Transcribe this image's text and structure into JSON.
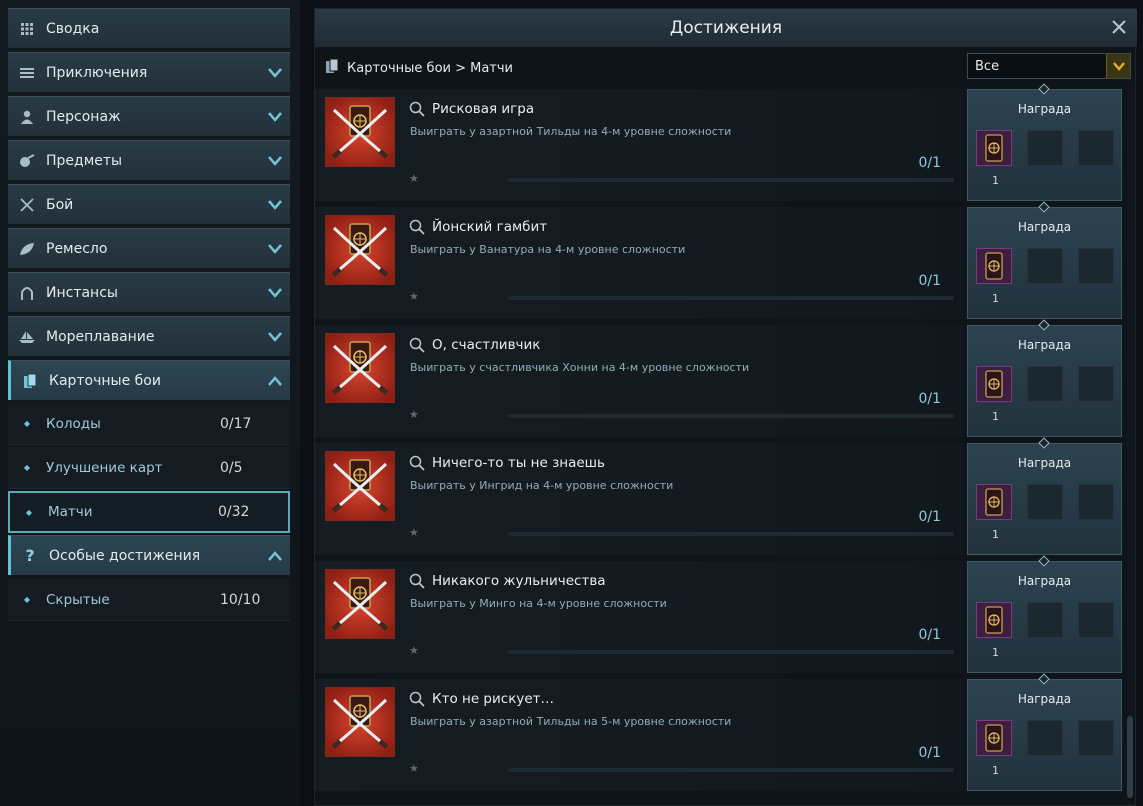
{
  "sidebar": {
    "items": [
      {
        "label": "Сводка",
        "icon": "grid-icon"
      },
      {
        "label": "Приключения",
        "icon": "list-icon"
      },
      {
        "label": "Персонаж",
        "icon": "person-icon"
      },
      {
        "label": "Предметы",
        "icon": "pouch-icon"
      },
      {
        "label": "Бой",
        "icon": "crossed-swords-icon"
      },
      {
        "label": "Ремесло",
        "icon": "leaf-icon"
      },
      {
        "label": "Инстансы",
        "icon": "arch-icon"
      },
      {
        "label": "Мореплавание",
        "icon": "ship-icon"
      },
      {
        "label": "Карточные бои",
        "icon": "cards-icon"
      },
      {
        "label": "Особые достижения",
        "icon": "question-icon"
      }
    ],
    "card_sub": [
      {
        "label": "Колоды",
        "count": "0/17"
      },
      {
        "label": "Улучшение карт",
        "count": "0/5"
      },
      {
        "label": "Матчи",
        "count": "0/32"
      }
    ],
    "special_sub": [
      {
        "label": "Скрытые",
        "count": "10/10"
      }
    ]
  },
  "main": {
    "title": "Достижения",
    "breadcrumb": "Карточные бои > Матчи",
    "filter": {
      "value": "Все"
    },
    "reward_label": "Награда",
    "achievements": [
      {
        "title": "Рисковая игра",
        "desc": "Выиграть у азартной Тильды на 4-м уровне сложности",
        "progress": "0/1",
        "reward_count": "1"
      },
      {
        "title": "Йонский гамбит",
        "desc": "Выиграть у Ванатура на 4-м уровне сложности",
        "progress": "0/1",
        "reward_count": "1"
      },
      {
        "title": "О, счастливчик",
        "desc": "Выиграть у счастливчика Хонни на 4-м уровне сложности",
        "progress": "0/1",
        "reward_count": "1"
      },
      {
        "title": "Ничего-то ты не знаешь",
        "desc": "Выиграть у Ингрид на 4-м уровне сложности",
        "progress": "0/1",
        "reward_count": "1"
      },
      {
        "title": "Никакого жульничества",
        "desc": "Выиграть у Минго на 4-м уровне сложности",
        "progress": "0/1",
        "reward_count": "1"
      },
      {
        "title": "Кто не рискует…",
        "desc": "Выиграть у азартной Тильды на 5-м уровне сложности",
        "progress": "0/1",
        "reward_count": "1"
      }
    ]
  },
  "colors": {
    "accent": "#5fc2d8",
    "icon_red": "#b52d1f",
    "filter_arrow": "#e0b020"
  }
}
